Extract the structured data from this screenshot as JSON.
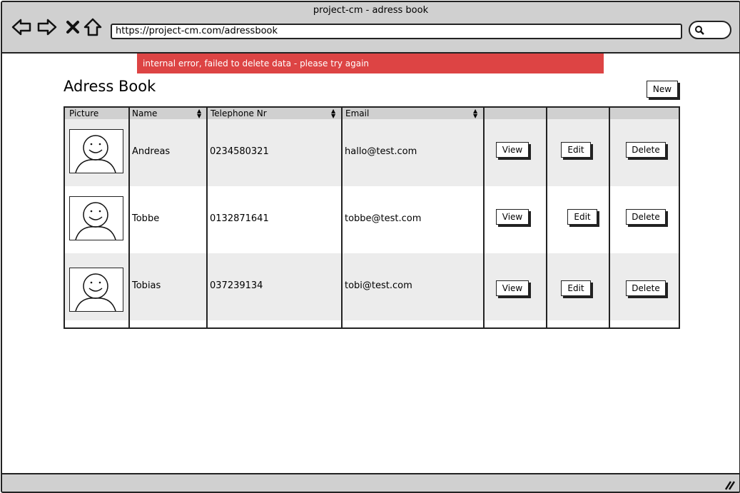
{
  "window": {
    "title": "project-cm - adress book"
  },
  "browser": {
    "url": "https://project-cm.com/adressbook",
    "icons": [
      "back-arrow-icon",
      "forward-arrow-icon",
      "close-icon",
      "home-icon",
      "search-icon"
    ]
  },
  "error": {
    "message": "internal error, failed to delete data - please try again"
  },
  "page": {
    "title": "Adress Book",
    "new_label": "New"
  },
  "table": {
    "headers": {
      "picture": "Picture",
      "name": "Name",
      "telephone": "Telephone Nr",
      "email": "Email"
    },
    "rows": [
      {
        "name": "Andreas",
        "telephone": "0234580321",
        "email": "hallo@test.com"
      },
      {
        "name": "Tobbe",
        "telephone": "0132871641",
        "email": "tobbe@test.com"
      },
      {
        "name": "Tobias",
        "telephone": "037239134",
        "email": "tobi@test.com"
      }
    ],
    "actions": {
      "view": "View",
      "edit": "Edit",
      "delete": "Delete"
    }
  },
  "colors": {
    "error_bg": "#dd4444",
    "chrome_bg": "#d0d0d0",
    "row_shade": "#ececec"
  }
}
